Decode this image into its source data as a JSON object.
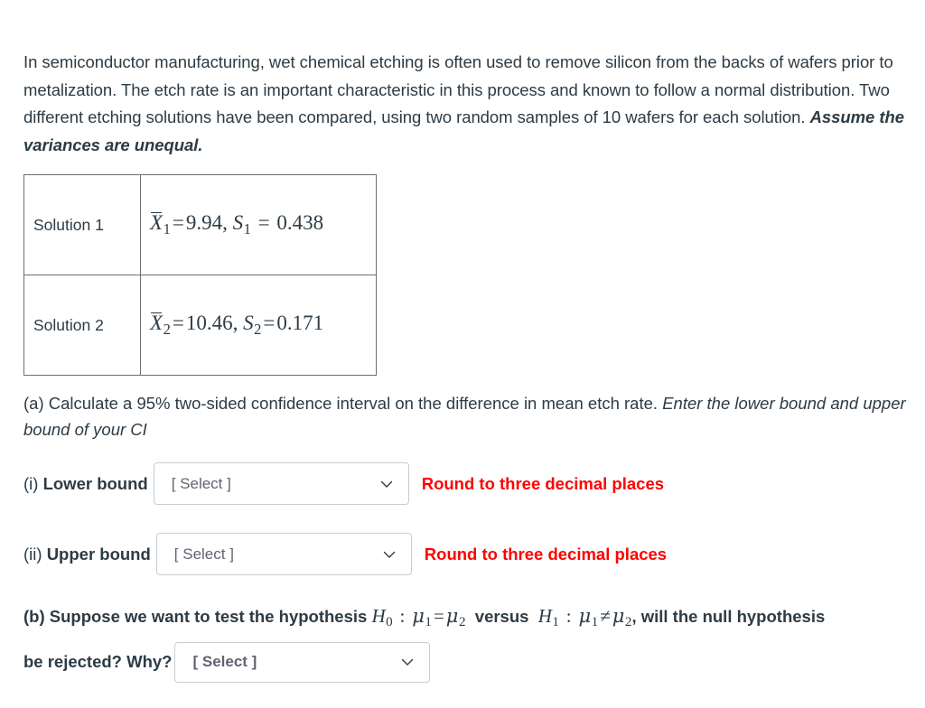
{
  "problem": {
    "intro_part1": "In semiconductor manufacturing, wet chemical etching is often used to remove silicon from the backs of wafers prior to metalization. The etch rate is an important characteristic in this process and known to follow a normal distribution. Two different etching solutions have been compared, using two random samples of 10 wafers for each solution. ",
    "intro_emphasis": "Assume the variances are unequal."
  },
  "table": {
    "rows": [
      {
        "label": "Solution 1",
        "mean_symbol": "X",
        "mean_sub": "1",
        "mean_value": "9.94",
        "sd_symbol": "S",
        "sd_sub": "1",
        "sd_value": "0.438",
        "separator": ",",
        "eq": "=",
        "spacing": "wide"
      },
      {
        "label": "Solution 2",
        "mean_symbol": "X",
        "mean_sub": "2",
        "mean_value": "10.46",
        "sd_symbol": "S",
        "sd_sub": "2",
        "sd_value": "0.171",
        "separator": ",",
        "eq": "=",
        "spacing": "tight"
      }
    ]
  },
  "part_a": {
    "text": "(a) Calculate a 95% two-sided confidence interval on the difference in mean etch rate. ",
    "emphasis": "Enter the lower bound and upper bound of your CI"
  },
  "answers": {
    "lower": {
      "marker": "(i) ",
      "label": "Lower bound",
      "select_value": "[ Select ]",
      "note": "Round to three decimal places"
    },
    "upper": {
      "marker": "(ii) ",
      "label": "Upper bound",
      "select_value": "[ Select ]",
      "note": "Round to three decimal places"
    }
  },
  "part_b": {
    "text_before": "(b) Suppose we want to test the hypothesis ",
    "h0_symbol": "H",
    "h0_sub": "0",
    "colon": ":",
    "mu1": "μ",
    "mu1_sub": "1",
    "equals": "=",
    "mu2": "μ",
    "mu2_sub": "2",
    "versus": "versus",
    "h1_symbol": "H",
    "h1_sub": "1",
    "mu1b": "μ",
    "mu1b_sub": "1",
    "notequals": "≠",
    "mu2b": "μ",
    "mu2b_sub": "2",
    "comma_after": ", will the null hypothesis",
    "line2": "be rejected? Why?",
    "select_value": "[ Select ]"
  },
  "colors": {
    "text": "#2d3b45",
    "note_red": "#ff0000",
    "border": "#6a6f73",
    "select_border": "#c7cdd1"
  },
  "icons": {
    "chevron": "chevron-down-icon"
  }
}
